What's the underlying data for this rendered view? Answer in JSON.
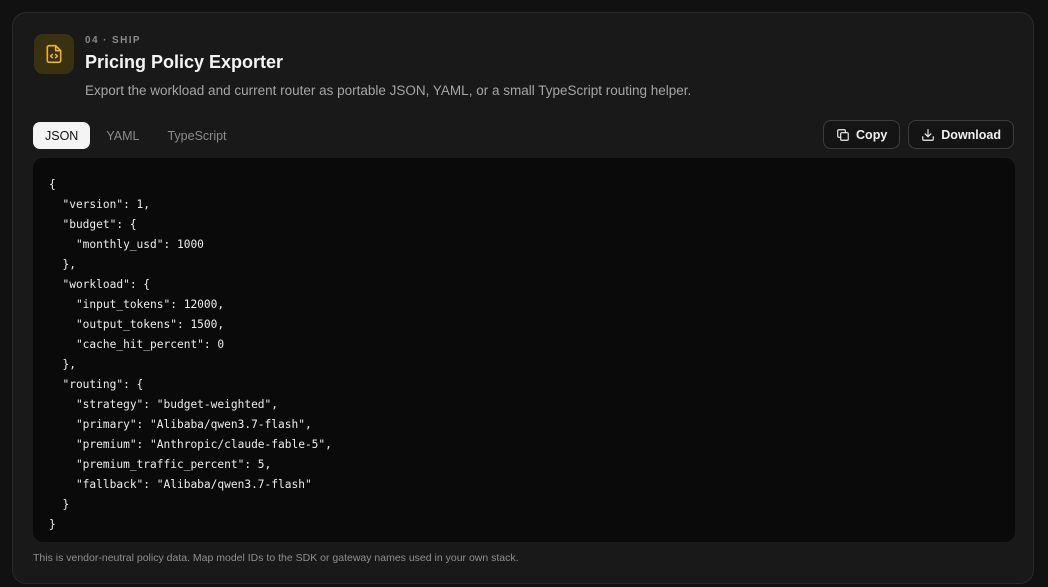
{
  "header": {
    "icon": "code-file-icon",
    "eyebrow": "04 · SHIP",
    "title": "Pricing Policy Exporter",
    "subtitle": "Export the workload and current router as portable JSON, YAML, or a small TypeScript routing helper."
  },
  "tabs": [
    {
      "label": "JSON",
      "active": true
    },
    {
      "label": "YAML",
      "active": false
    },
    {
      "label": "TypeScript",
      "active": false
    }
  ],
  "actions": {
    "copy": {
      "label": "Copy",
      "icon": "copy-icon"
    },
    "download": {
      "label": "Download",
      "icon": "download-icon"
    }
  },
  "code": "{\n  \"version\": 1,\n  \"budget\": {\n    \"monthly_usd\": 1000\n  },\n  \"workload\": {\n    \"input_tokens\": 12000,\n    \"output_tokens\": 1500,\n    \"cache_hit_percent\": 0\n  },\n  \"routing\": {\n    \"strategy\": \"budget-weighted\",\n    \"primary\": \"Alibaba/qwen3.7-flash\",\n    \"premium\": \"Anthropic/claude-fable-5\",\n    \"premium_traffic_percent\": 5,\n    \"fallback\": \"Alibaba/qwen3.7-flash\"\n  }\n}",
  "footnote": "This is vendor-neutral policy data. Map model IDs to the SDK or gateway names used in your own stack.",
  "colors": {
    "accent": "#f0b429",
    "icon_bg": "#3a3110",
    "card_bg": "#191919",
    "code_bg": "#0a0a0a"
  }
}
